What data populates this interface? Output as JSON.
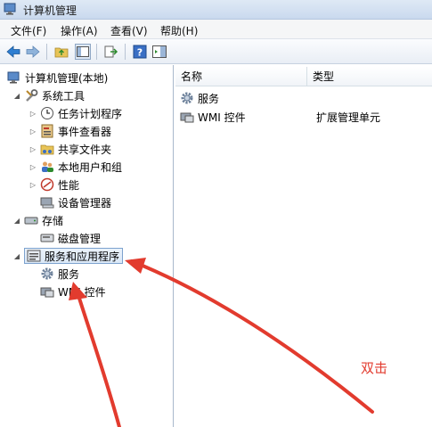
{
  "window": {
    "title": "计算机管理"
  },
  "menu": [
    {
      "label": "文件(F)"
    },
    {
      "label": "操作(A)"
    },
    {
      "label": "查看(V)"
    },
    {
      "label": "帮助(H)"
    }
  ],
  "toolbar": {
    "buttons": [
      "back-icon",
      "forward-icon",
      "up-folder-icon",
      "show-hide-tree-icon",
      "export-list-icon",
      "help-icon",
      "action-pane-icon"
    ]
  },
  "tree": {
    "root": "计算机管理(本地)",
    "system_tools": "系统工具",
    "task_scheduler": "任务计划程序",
    "event_viewer": "事件查看器",
    "shared_folders": "共享文件夹",
    "local_users": "本地用户和组",
    "performance": "性能",
    "device_manager": "设备管理器",
    "storage": "存储",
    "disk_management": "磁盘管理",
    "services_apps": "服务和应用程序",
    "services": "服务",
    "wmi": "WMI 控件"
  },
  "list": {
    "columns": [
      "名称",
      "类型"
    ],
    "rows": [
      {
        "name": "服务",
        "type": ""
      },
      {
        "name": "WMI 控件",
        "type": "扩展管理单元"
      }
    ]
  },
  "annotation": {
    "text": "双击",
    "color": "#e23b2e"
  }
}
